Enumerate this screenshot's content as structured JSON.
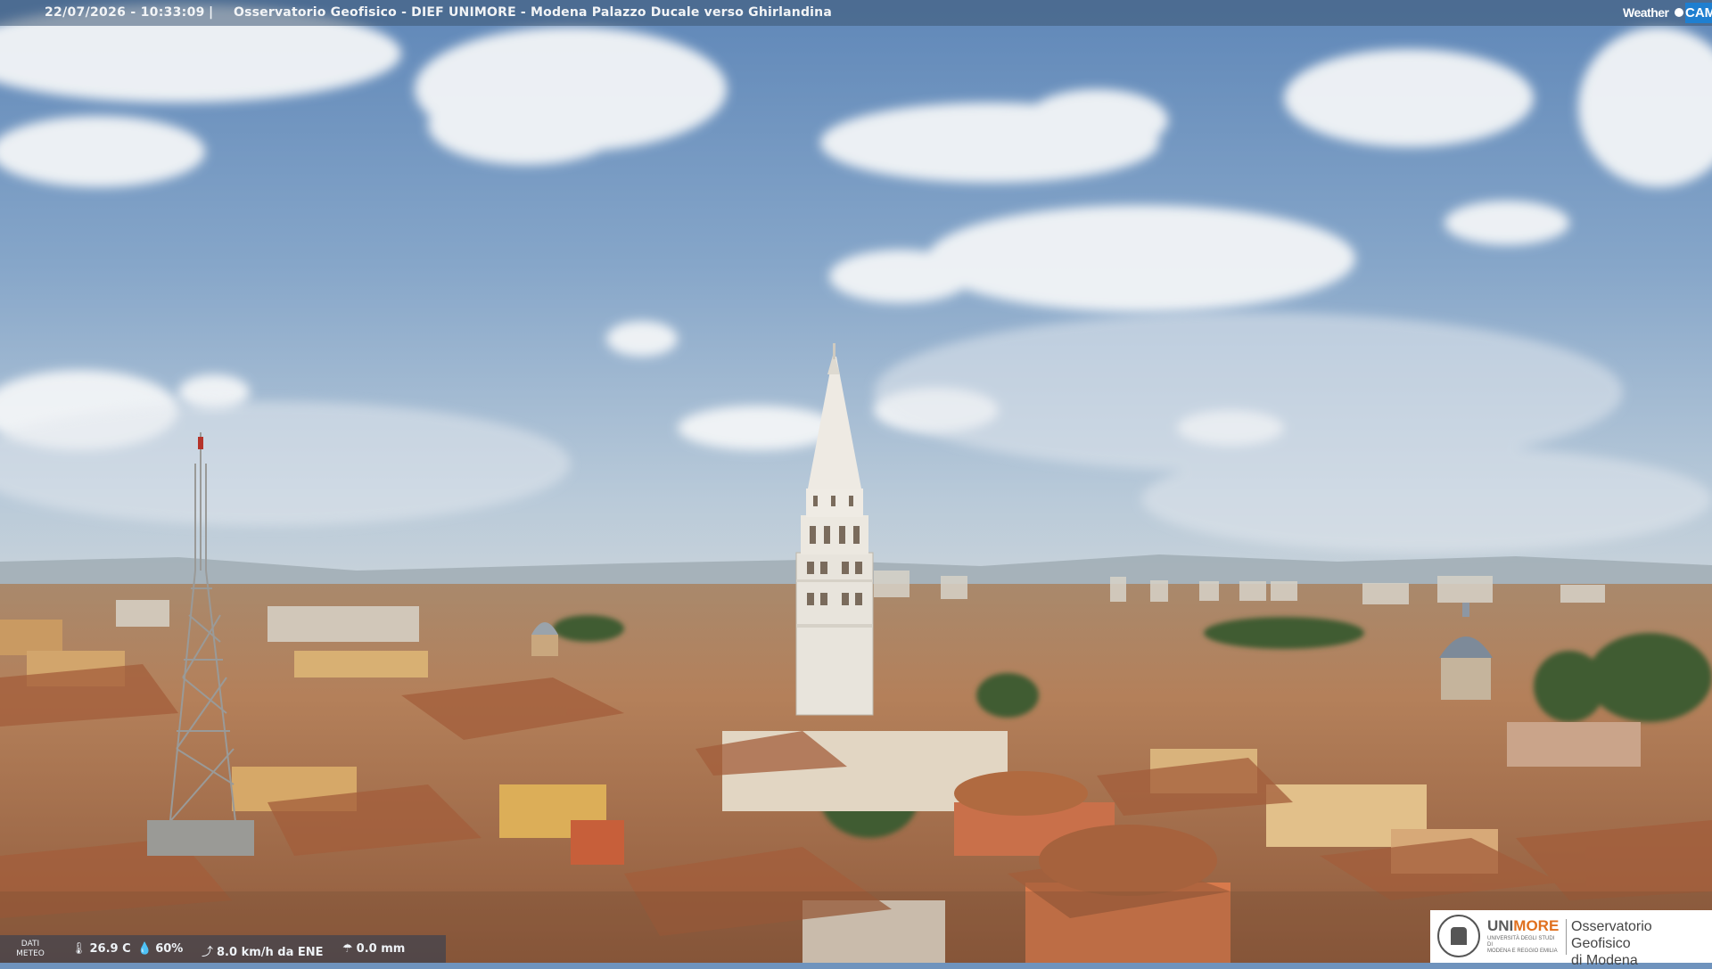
{
  "header": {
    "timestamp": "22/07/2026 - 10:33:09",
    "separator": "|",
    "caption": "Osservatorio Geofisico - DIEF UNIMORE - Modena Palazzo Ducale verso Ghirlandina",
    "brand_weather": "Weather",
    "brand_cam": "CAM"
  },
  "weather": {
    "label_line1": "DATI",
    "label_line2": "METEO",
    "temperature": "26.9 C",
    "humidity": "60%",
    "wind": "8.0 km/h da ENE",
    "rain": "0.0 mm",
    "icons": [
      "thermometer-icon",
      "humidity-drop-icon",
      "wind-icon",
      "rain-icon"
    ]
  },
  "logo": {
    "name_prefix": "UNI",
    "name_highlight": "MORE",
    "subtitle_line1": "UNIVERSITÀ DEGLI STUDI DI",
    "subtitle_line2": "MODENA E REGGIO EMILIA",
    "org_line1": "Osservatorio Geofisico",
    "org_line2": "di Modena"
  },
  "colors": {
    "sky_top": "#6e92bd",
    "sky_horizon": "#c9d6e2",
    "roof": "#b8764e",
    "tower": "#e9e6df",
    "accent_orange": "#e0701e",
    "brand_blue": "#1f7fd0"
  }
}
